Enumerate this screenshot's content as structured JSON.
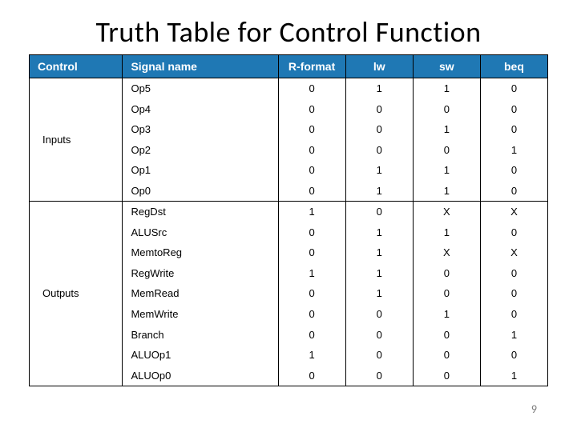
{
  "title": "Truth Table for Control Function",
  "page_number": "9",
  "headers": {
    "control": "Control",
    "signal": "Signal name",
    "rformat": "R-format",
    "lw": "lw",
    "sw": "sw",
    "beq": "beq"
  },
  "groups": [
    {
      "label": "Inputs",
      "rows": [
        {
          "signal": "Op5",
          "rformat": "0",
          "lw": "1",
          "sw": "1",
          "beq": "0"
        },
        {
          "signal": "Op4",
          "rformat": "0",
          "lw": "0",
          "sw": "0",
          "beq": "0"
        },
        {
          "signal": "Op3",
          "rformat": "0",
          "lw": "0",
          "sw": "1",
          "beq": "0"
        },
        {
          "signal": "Op2",
          "rformat": "0",
          "lw": "0",
          "sw": "0",
          "beq": "1"
        },
        {
          "signal": "Op1",
          "rformat": "0",
          "lw": "1",
          "sw": "1",
          "beq": "0"
        },
        {
          "signal": "Op0",
          "rformat": "0",
          "lw": "1",
          "sw": "1",
          "beq": "0"
        }
      ]
    },
    {
      "label": "Outputs",
      "rows": [
        {
          "signal": "RegDst",
          "rformat": "1",
          "lw": "0",
          "sw": "X",
          "beq": "X"
        },
        {
          "signal": "ALUSrc",
          "rformat": "0",
          "lw": "1",
          "sw": "1",
          "beq": "0"
        },
        {
          "signal": "MemtoReg",
          "rformat": "0",
          "lw": "1",
          "sw": "X",
          "beq": "X"
        },
        {
          "signal": "RegWrite",
          "rformat": "1",
          "lw": "1",
          "sw": "0",
          "beq": "0"
        },
        {
          "signal": "MemRead",
          "rformat": "0",
          "lw": "1",
          "sw": "0",
          "beq": "0"
        },
        {
          "signal": "MemWrite",
          "rformat": "0",
          "lw": "0",
          "sw": "1",
          "beq": "0"
        },
        {
          "signal": "Branch",
          "rformat": "0",
          "lw": "0",
          "sw": "0",
          "beq": "1"
        },
        {
          "signal": "ALUOp1",
          "rformat": "1",
          "lw": "0",
          "sw": "0",
          "beq": "0"
        },
        {
          "signal": "ALUOp0",
          "rformat": "0",
          "lw": "0",
          "sw": "0",
          "beq": "1"
        }
      ]
    }
  ]
}
